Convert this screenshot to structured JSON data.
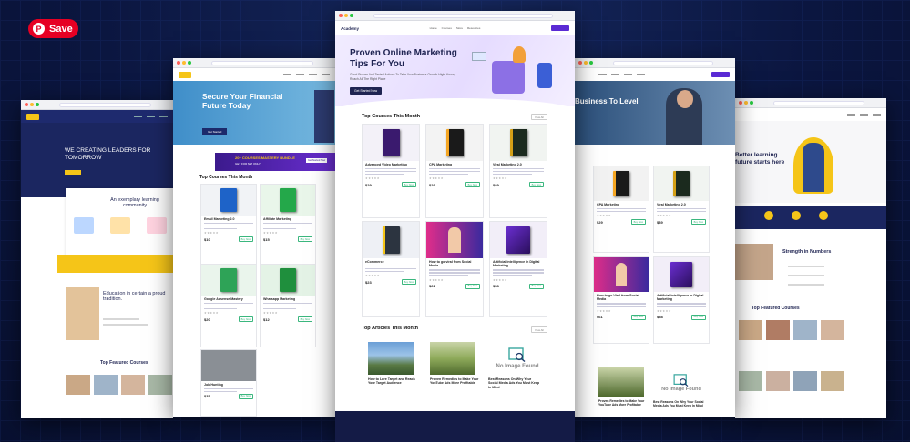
{
  "pin": {
    "save_label": "Save",
    "pin_glyph": "P"
  },
  "main": {
    "brand": "Academy",
    "nav": [
      "Home",
      "Courses",
      "Store",
      "Resources"
    ],
    "hero_title": "Proven Online Marketing Tips For You",
    "hero_subtitle": "Good Proven And Tested Actions To Take Your Business Growth High, Know, Reach All The Right Place",
    "hero_button": "Get Started Now",
    "courses_title": "Top Courses This Month",
    "view_all": "View All",
    "courses": [
      {
        "title": "Advanced Video Marketing",
        "price": "$29",
        "buy": "Buy Now",
        "color": "#3a1a6e"
      },
      {
        "title": "CPA Marketing",
        "price": "$29",
        "buy": "Buy Now",
        "color": "#1a1a1a"
      },
      {
        "title": "Viral Marketing 2.0",
        "price": "$89",
        "buy": "Buy Now",
        "color": "#1b2a1e"
      },
      {
        "title": "eCommerce",
        "price": "$23",
        "buy": "Buy Now",
        "color": "#e8eaf0"
      },
      {
        "title": "How to go viral from Social Media",
        "price": "$61",
        "buy": "Buy Now",
        "color": "#c23a8e"
      },
      {
        "title": "Artificial Intelligence in Digital Marketing",
        "price": "$58",
        "buy": "Buy Now",
        "color": "#5b2a8c"
      }
    ],
    "articles_title": "Top Articles This Month",
    "articles": [
      {
        "title": "How to Lure Target and Reach Your Target Audience"
      },
      {
        "title": "Proven Remedies to Make Your YouTube Ads More Profitable"
      },
      {
        "title": "Best Reasons On Why Your Social Media Ads You Must Keep In Mind",
        "image_text": "No Image Found"
      }
    ]
  },
  "left2": {
    "hero_title": "Secure Your Financial Future Today",
    "hero_button": "Get Started",
    "banner": "20+ COURSES MASTERY BUNDLE",
    "banner_sub": "GET FOR $27 ONLY",
    "banner_button": "Get Started Now",
    "courses_title": "Top Courses This Month",
    "courses": [
      {
        "title": "Email Marketing 2.0",
        "price": "$10"
      },
      {
        "title": "Affiliate Marketing",
        "price": "$15"
      },
      {
        "title": "Google Adsense Mastery",
        "price": "$20"
      },
      {
        "title": "Whatsapp Marketing",
        "price": "$12"
      },
      {
        "title": "Job Hunting",
        "price": "$35"
      }
    ]
  },
  "left1": {
    "hero_title": "WE CREATING LEADERS FOR TOMORROW",
    "section_title": "An exemplary learning community",
    "education_title": "Education in certain a proud tradition.",
    "featured_title": "Top Featured Courses"
  },
  "right2": {
    "hero_title": "Business To Level",
    "courses": [
      {
        "title": "CPA Marketing",
        "price": "$29"
      },
      {
        "title": "Viral Marketing 2.0",
        "price": "$89"
      },
      {
        "title": "How to go Viral from Social Media",
        "price": "$61"
      },
      {
        "title": "Artificial Intelligence in Digital Marketing",
        "price": "$58"
      }
    ],
    "articles": [
      {
        "title": "Proven Remedies to Make Your YouTube Ads More Profitable"
      },
      {
        "title": "Best Reasons On Why Your Social Media Ads You Must Keep In Mind",
        "image_text": "No Image Found"
      }
    ]
  },
  "right1": {
    "hero_title": "Better learning future starts here",
    "strength_title": "Strength in Numbers",
    "featured_title": "Top Featured Courses"
  }
}
